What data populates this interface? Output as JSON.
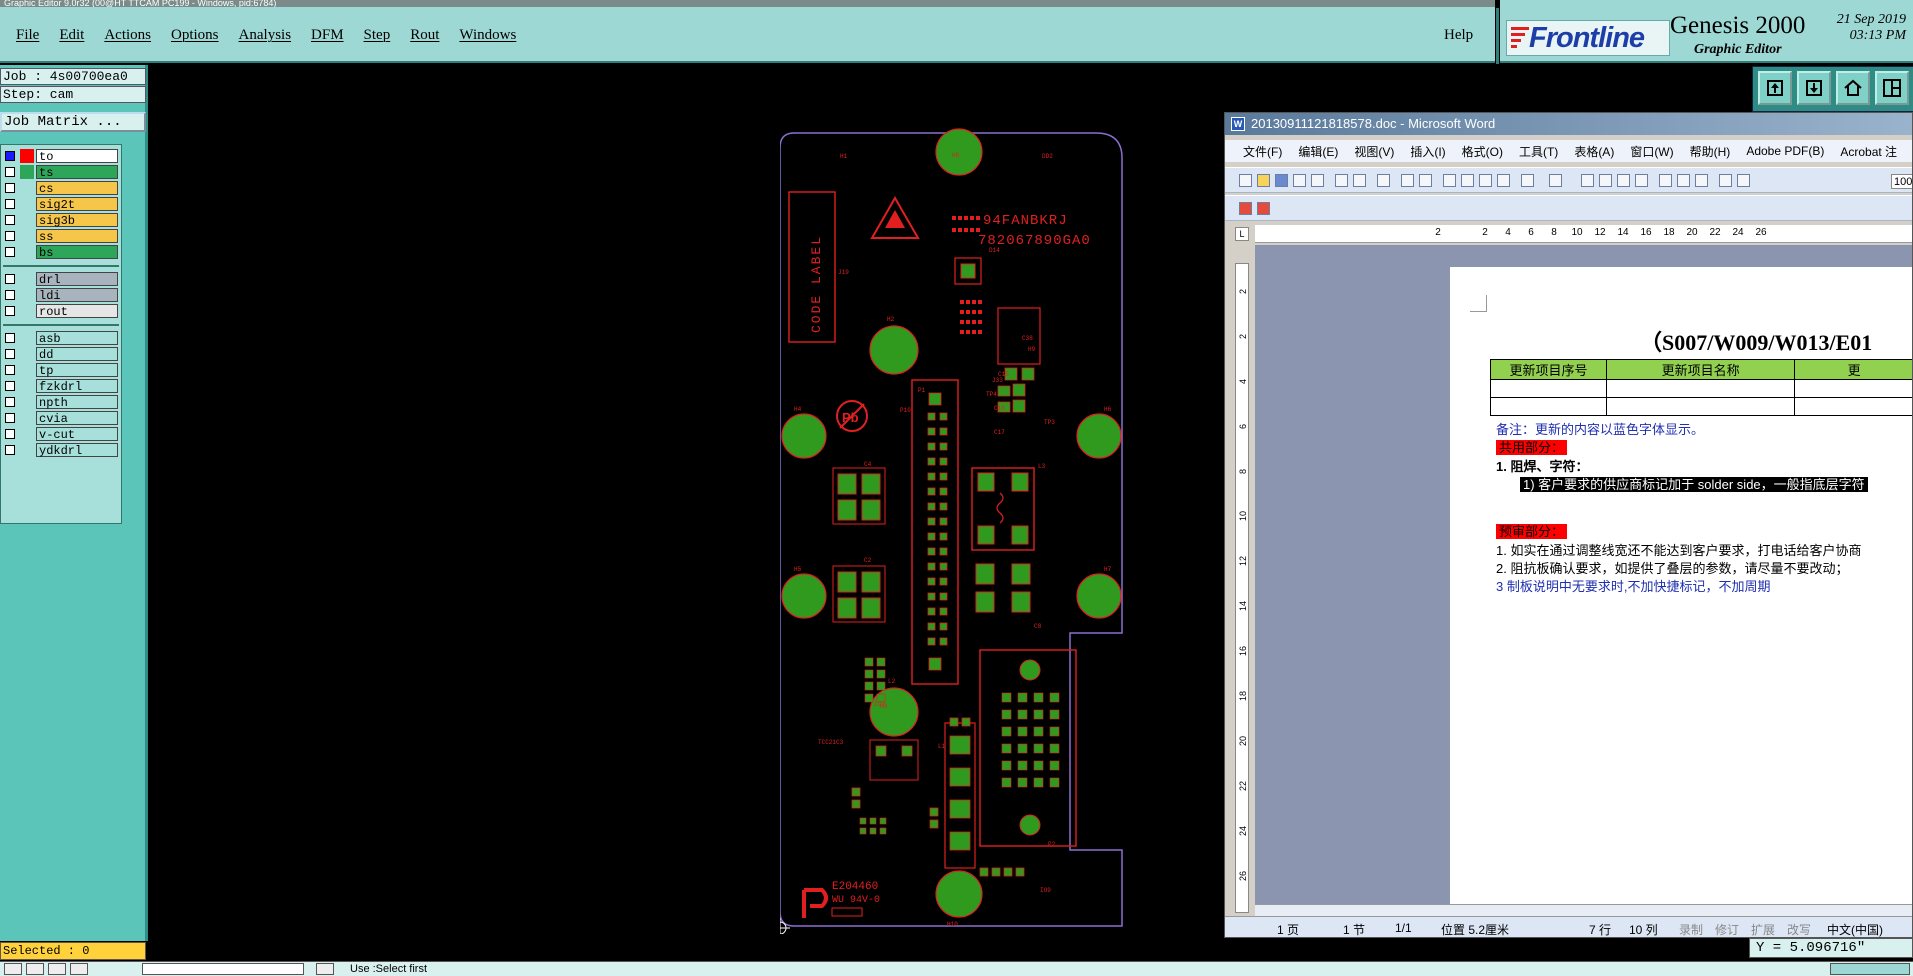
{
  "window_title": "Graphic Editor 9.0r32 (00@HT TTCAM PC199 - Windows, pid:6784)",
  "menubar": {
    "items": [
      "File",
      "Edit",
      "Actions",
      "Options",
      "Analysis",
      "DFM",
      "Step",
      "Rout",
      "Windows"
    ],
    "help": "Help"
  },
  "brand": {
    "logo": "Frontline",
    "product": "Genesis 2000",
    "subtitle": "Graphic Editor",
    "date": "21 Sep 2019",
    "time": "03:13 PM"
  },
  "left_panel": {
    "job": "Job : 4s00700ea0",
    "step": "Step: cam",
    "job_matrix": "Job Matrix ...",
    "layers_group1": [
      {
        "name": "to",
        "color": "#ffffff",
        "swatch": "#ff0000",
        "checked": true
      },
      {
        "name": "ts",
        "color": "#2ea65a",
        "swatch": "#2ea65a",
        "checked": false
      },
      {
        "name": "cs",
        "color": "#f5c64a",
        "swatch": "",
        "checked": false
      },
      {
        "name": "sig2t",
        "color": "#f5c64a",
        "swatch": "",
        "checked": false
      },
      {
        "name": "sig3b",
        "color": "#f5c64a",
        "swatch": "",
        "checked": false
      },
      {
        "name": "ss",
        "color": "#f5c64a",
        "swatch": "",
        "checked": false
      },
      {
        "name": "bs",
        "color": "#2ea65a",
        "swatch": "",
        "checked": false
      }
    ],
    "layers_group2": [
      {
        "name": "drl",
        "color": "#a8b4bd"
      },
      {
        "name": "ldi",
        "color": "#a8b4bd"
      },
      {
        "name": "rout",
        "color": "#e6e6e6"
      }
    ],
    "layers_group3": [
      {
        "name": "asb"
      },
      {
        "name": "dd"
      },
      {
        "name": "tp"
      },
      {
        "name": "fzkdrl"
      },
      {
        "name": "npth"
      },
      {
        "name": "cvia"
      },
      {
        "name": "v-cut"
      },
      {
        "name": "ydkdrl"
      }
    ],
    "selected": "Selected : 0"
  },
  "status": {
    "y_coord": "Y = 5.096716\"",
    "message": "Use :Select first"
  },
  "pcb": {
    "code_label": "CODE LABEL",
    "marking_1": "94FANBKRJ",
    "marking_2": "782067890GA0",
    "ul_mark": "E204460",
    "ul_mark2": "WU 94V-0",
    "labels": [
      "H8",
      "H2",
      "H3",
      "H4",
      "H5",
      "H6",
      "H7",
      "H9",
      "H10",
      "H1",
      "P10",
      "L3",
      "L2",
      "L1",
      "P1",
      "P2",
      "D14",
      "C38",
      "C8",
      "C2",
      "C4",
      "C10",
      "C15",
      "C17",
      "TP3",
      "TP4",
      "J19",
      "J33",
      "DD2",
      "IO9",
      "IO1",
      "TCC21C3"
    ]
  },
  "word": {
    "title": "20130911121818578.doc - Microsoft Word",
    "menus": [
      "文件(F)",
      "编辑(E)",
      "视图(V)",
      "插入(I)",
      "格式(O)",
      "工具(T)",
      "表格(A)",
      "窗口(W)",
      "帮助(H)",
      "Adobe PDF(B)",
      "Acrobat 注"
    ],
    "zoom": "100",
    "ruler_ticks": [
      "2",
      "2",
      "4",
      "6",
      "8",
      "10",
      "12",
      "14",
      "16",
      "18",
      "20",
      "22",
      "24",
      "26"
    ],
    "vruler_ticks": [
      "2",
      "2",
      "4",
      "6",
      "8",
      "10",
      "12",
      "14",
      "16",
      "18",
      "20",
      "22",
      "24",
      "26"
    ],
    "heading": "（S007/W009/W013/E01",
    "table_headers": [
      "更新项目序号",
      "更新项目名称",
      "更"
    ],
    "note": "备注：更新的内容以蓝色字体显示。",
    "section1": "共用部分：",
    "item1": "1.   阻焊、字符：",
    "item1_sub": "1)   客户要求的供应商标记加于 solder side，一般指底层字符",
    "section2": "预审部分：",
    "p1": "1.    如实在通过调整线宽还不能达到客户要求，打电话给客户协商",
    "p2": "2.    阻抗板确认要求，如提供了叠层的参数，请尽量不要改动；",
    "p3": "3     制板说明中无要求时,不加快捷标记，不加周期",
    "status": {
      "page": "1 页",
      "section": "1 节",
      "pages": "1/1",
      "position": "位置 5.2厘米",
      "line": "7 行",
      "col": "10 列",
      "rec": "录制",
      "trk": "修订",
      "ext": "扩展",
      "ovr": "改写",
      "lang": "中文(中国)"
    }
  }
}
